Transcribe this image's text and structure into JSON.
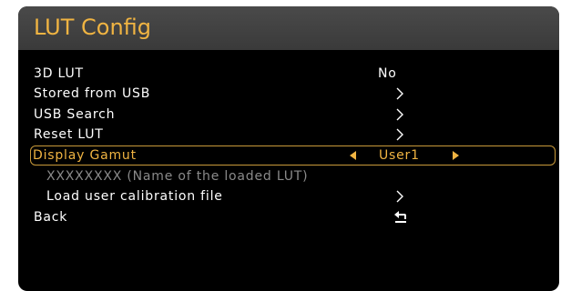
{
  "header": {
    "title": "LUT Config"
  },
  "menu": {
    "lut3d": {
      "label": "3D LUT",
      "value": "No"
    },
    "stored_usb": {
      "label": "Stored from USB"
    },
    "usb_search": {
      "label": "USB Search"
    },
    "reset_lut": {
      "label": "Reset LUT"
    },
    "display_gamut": {
      "label": "Display Gamut",
      "value": "User1"
    },
    "loaded_name": {
      "label": "XXXXXXXX (Name of the loaded LUT)"
    },
    "load_calibration": {
      "label": "Load user calibration file"
    },
    "back": {
      "label": "Back"
    }
  },
  "colors": {
    "accent": "#f0b442",
    "background": "#000000",
    "header": "#444444",
    "dim_text": "#8a8a8a"
  },
  "icons": {
    "submenu": "chevron-right-icon",
    "prev": "triangle-left-icon",
    "next": "triangle-right-icon",
    "back": "return-arrow-icon"
  }
}
